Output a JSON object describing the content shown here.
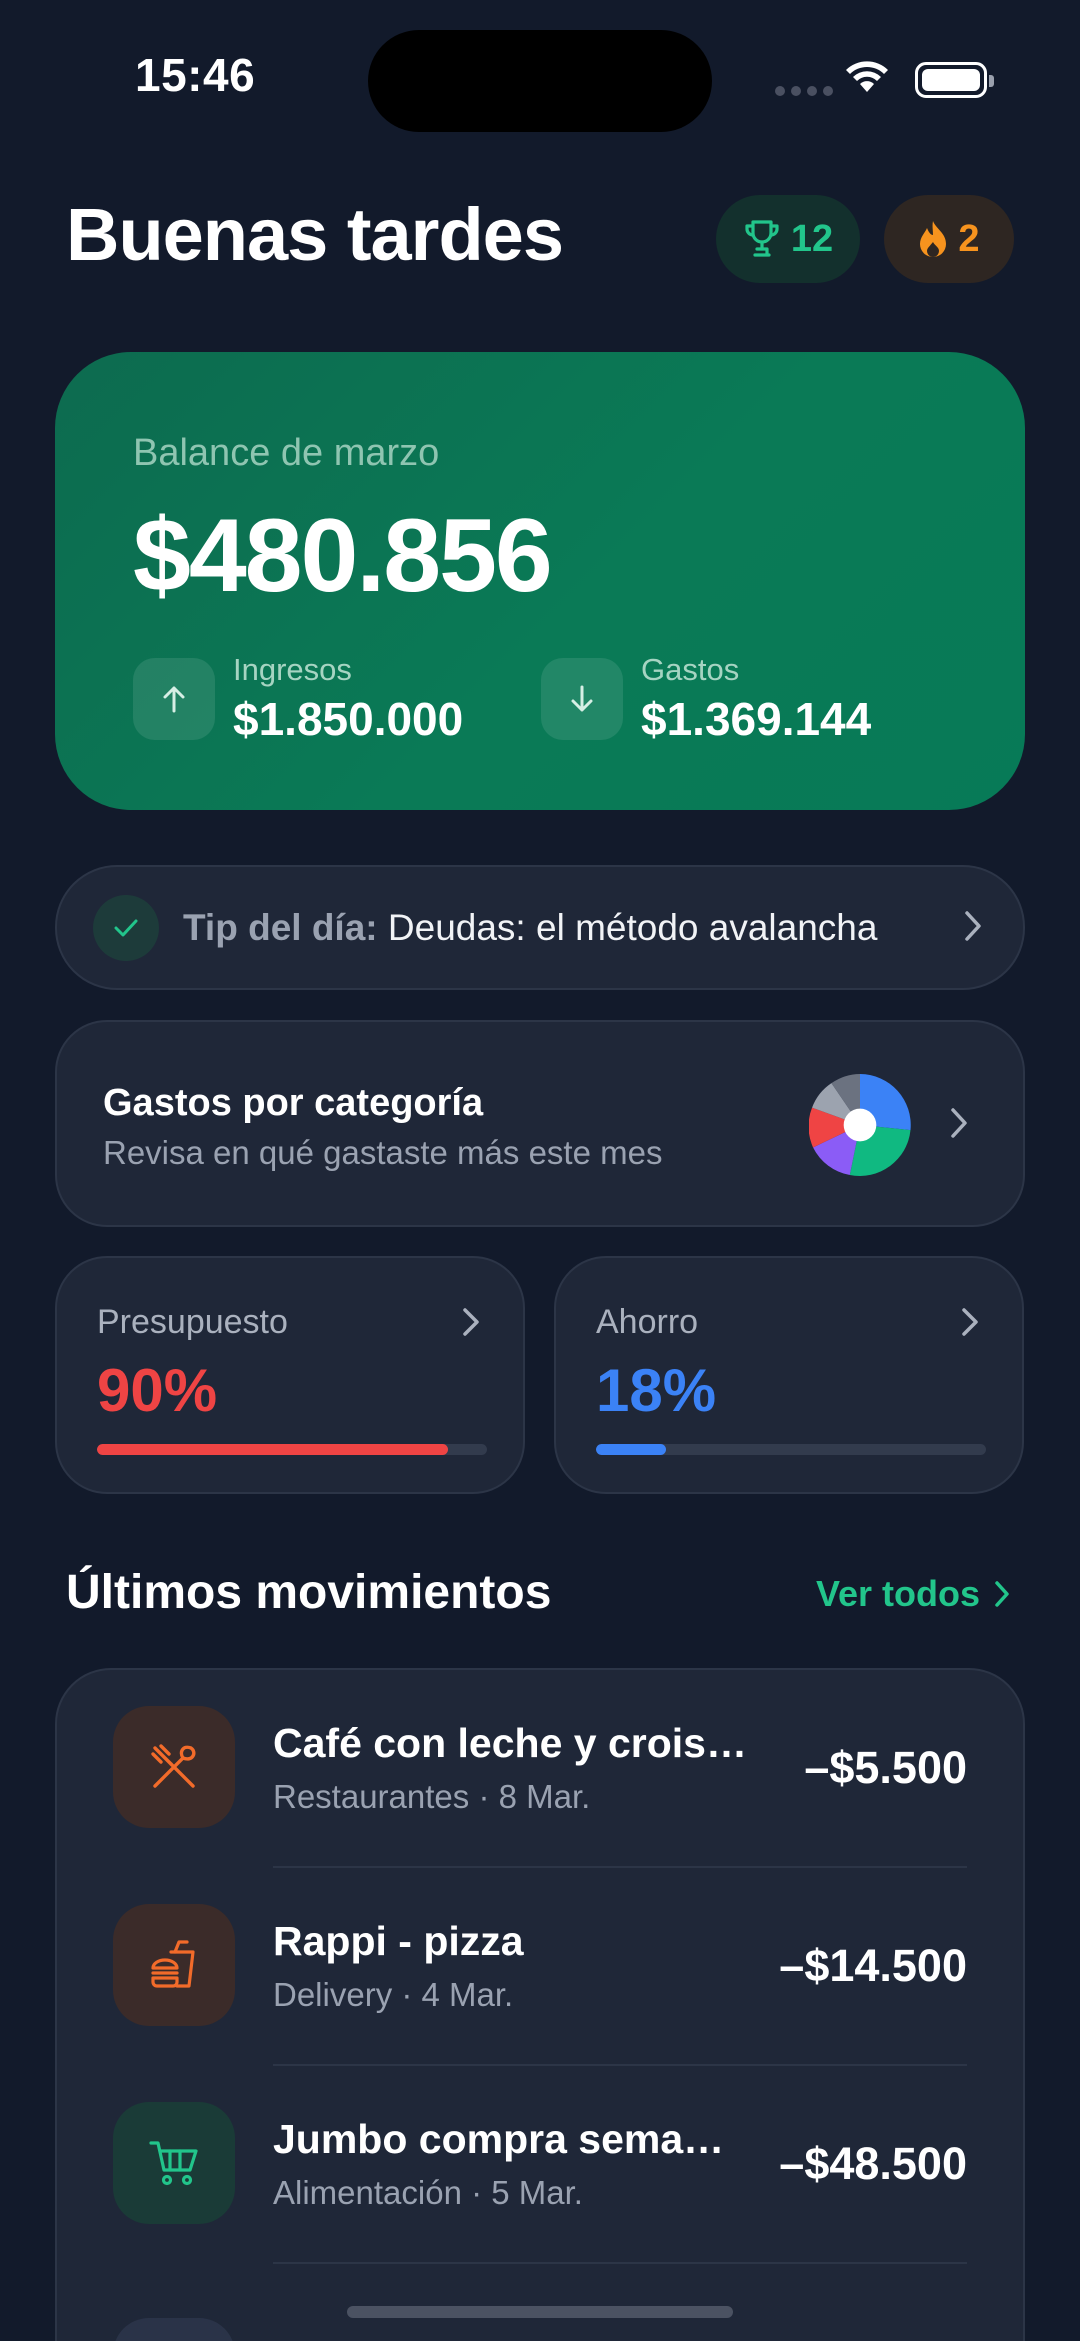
{
  "status_bar": {
    "time": "15:46"
  },
  "header": {
    "greeting": "Buenas tardes",
    "trophies": "12",
    "streak": "2"
  },
  "balance": {
    "label": "Balance de marzo",
    "amount": "$480.856",
    "income_label": "Ingresos",
    "income_value": "$1.850.000",
    "expense_label": "Gastos",
    "expense_value": "$1.369.144"
  },
  "tip": {
    "prefix": "Tip del día:",
    "text": "Deudas: el método avalancha"
  },
  "category": {
    "title": "Gastos por categoría",
    "subtitle": "Revisa en qué gastaste más este mes"
  },
  "budget": {
    "label": "Presupuesto",
    "value": "90%",
    "progress": 0.9,
    "color": "#ef4444"
  },
  "saving": {
    "label": "Ahorro",
    "value": "18%",
    "progress": 0.18,
    "color": "#3b82f6"
  },
  "movements": {
    "title": "Últimos movimientos",
    "see_all": "Ver todos",
    "items": [
      {
        "name": "Café con leche y croiss…",
        "meta": "Restaurantes · 8 Mar.",
        "amount": "–$5.500",
        "icon": "utensils-icon",
        "color": "#f26b2a"
      },
      {
        "name": "Rappi - pizza",
        "meta": "Delivery · 4 Mar.",
        "amount": "–$14.500",
        "icon": "fastfood-icon",
        "color": "#f26b2a"
      },
      {
        "name": "Jumbo compra sema…",
        "meta": "Alimentación · 5 Mar.",
        "amount": "–$48.500",
        "icon": "cart-icon",
        "color": "#22c58b"
      }
    ]
  },
  "colors": {
    "accent_green": "#22c58b",
    "streak_orange": "#f7931e",
    "background": "#121a2b"
  }
}
